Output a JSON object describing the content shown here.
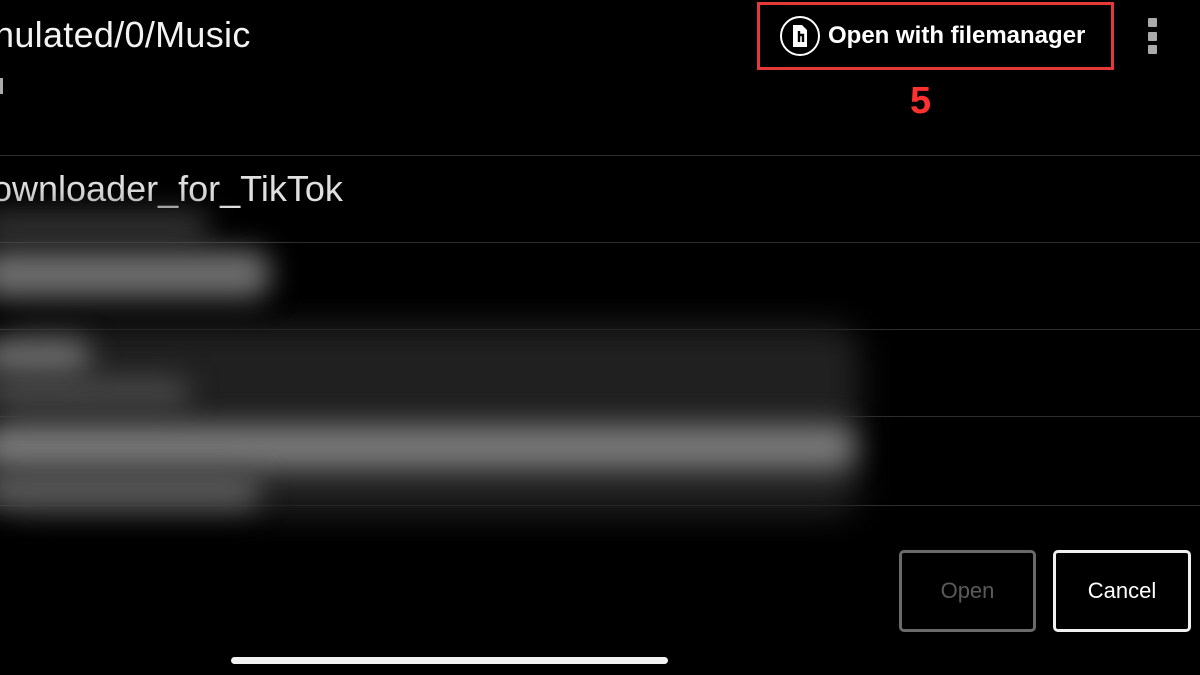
{
  "header": {
    "path": "nulated/0/Music",
    "open_with_filemanager": "Open with filemanager",
    "step_label": "5"
  },
  "file_list": {
    "items": [
      {
        "label": "ownloader_for_TikTok",
        "blurred": false
      }
    ]
  },
  "dialog_buttons": {
    "open_label": "Open",
    "cancel_label": "Cancel"
  },
  "colors": {
    "background": "#000000",
    "highlight": "#e53935",
    "step_number": "#ff3030",
    "disabled_text": "#5a5a5a"
  },
  "icons": {
    "filemanager": "file-manager-icon",
    "menu": "overflow-menu-icon"
  }
}
